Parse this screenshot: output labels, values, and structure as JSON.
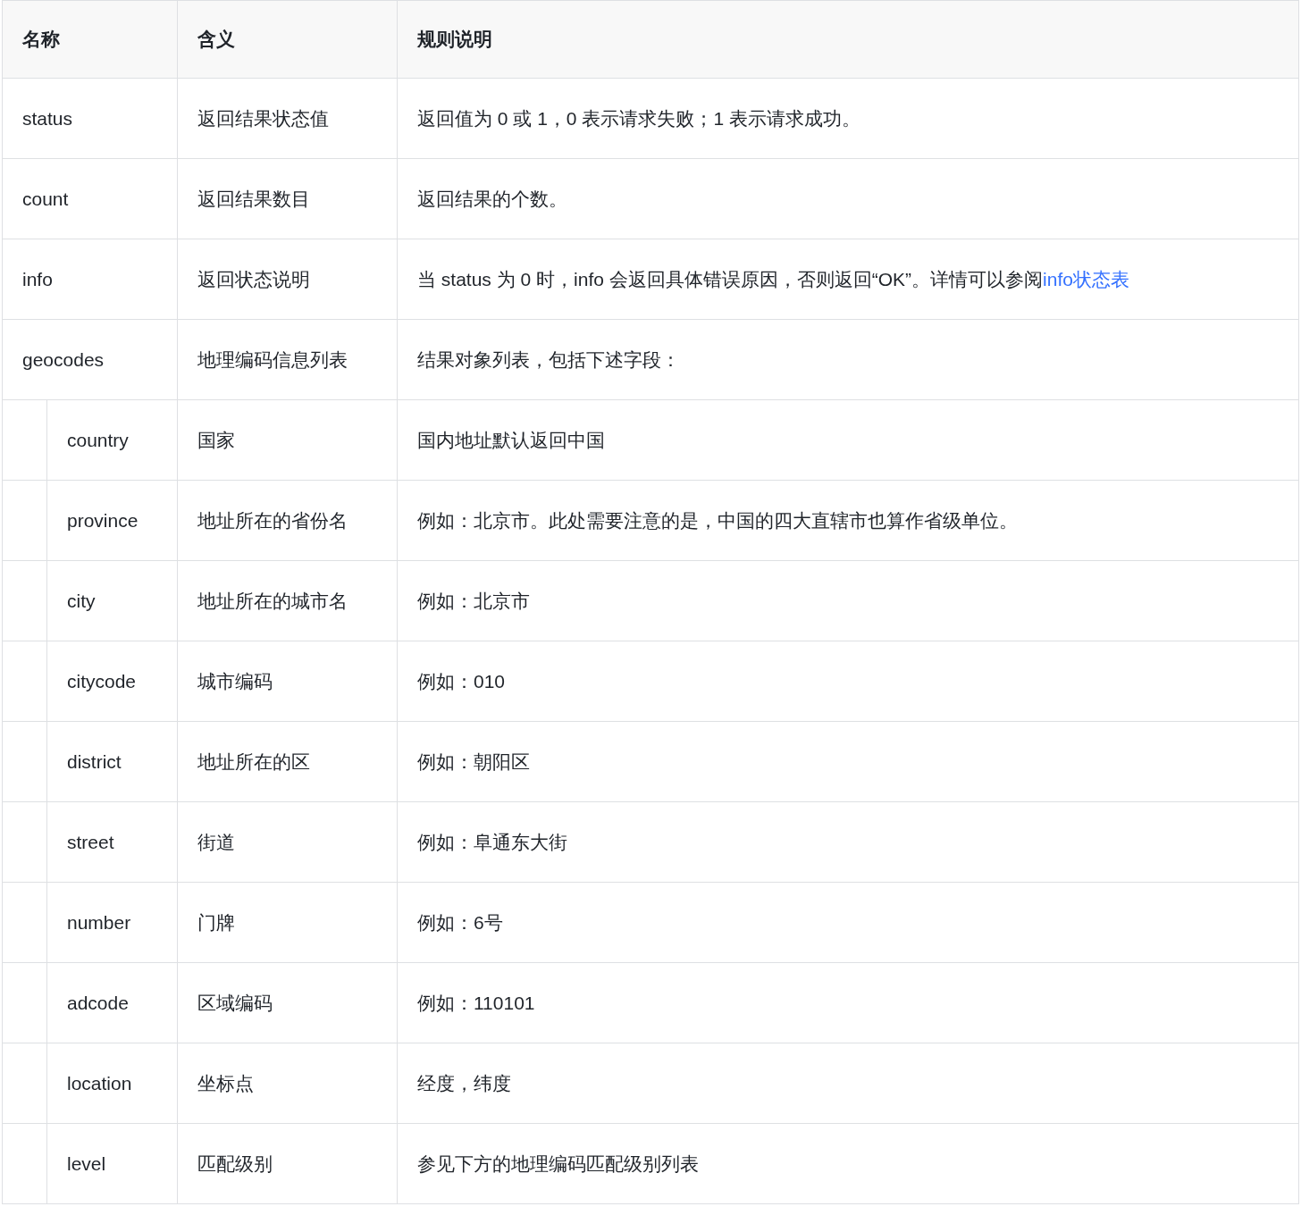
{
  "table": {
    "columns": [
      "名称",
      "含义",
      "规则说明"
    ],
    "rows": [
      {
        "name": "status",
        "meaning": "返回结果状态值",
        "rule": "返回值为 0 或 1，0 表示请求失败；1 表示请求成功。"
      },
      {
        "name": "count",
        "meaning": "返回结果数目",
        "rule": "返回结果的个数。"
      },
      {
        "name": "info",
        "meaning": "返回状态说明",
        "rule": "当 status 为 0 时，info 会返回具体错误原因，否则返回“OK”。详情可以参阅",
        "link": "info状态表"
      },
      {
        "name": "geocodes",
        "meaning": "地理编码信息列表",
        "rule": "结果对象列表，包括下述字段：",
        "children": [
          {
            "name": "country",
            "meaning": "国家",
            "rule": "国内地址默认返回中国"
          },
          {
            "name": "province",
            "meaning": "地址所在的省份名",
            "rule": "例如：北京市。此处需要注意的是，中国的四大直辖市也算作省级单位。"
          },
          {
            "name": "city",
            "meaning": "地址所在的城市名",
            "rule": "例如：北京市"
          },
          {
            "name": "citycode",
            "meaning": "城市编码",
            "rule": "例如：010"
          },
          {
            "name": "district",
            "meaning": "地址所在的区",
            "rule": "例如：朝阳区"
          },
          {
            "name": "street",
            "meaning": "街道",
            "rule": "例如：阜通东大街"
          },
          {
            "name": "number",
            "meaning": "门牌",
            "rule": "例如：6号"
          },
          {
            "name": "adcode",
            "meaning": "区域编码",
            "rule": "例如：110101"
          },
          {
            "name": "location",
            "meaning": "坐标点",
            "rule": "经度，纬度"
          },
          {
            "name": "level",
            "meaning": "匹配级别",
            "rule": "参见下方的地理编码匹配级别列表"
          }
        ]
      }
    ]
  }
}
